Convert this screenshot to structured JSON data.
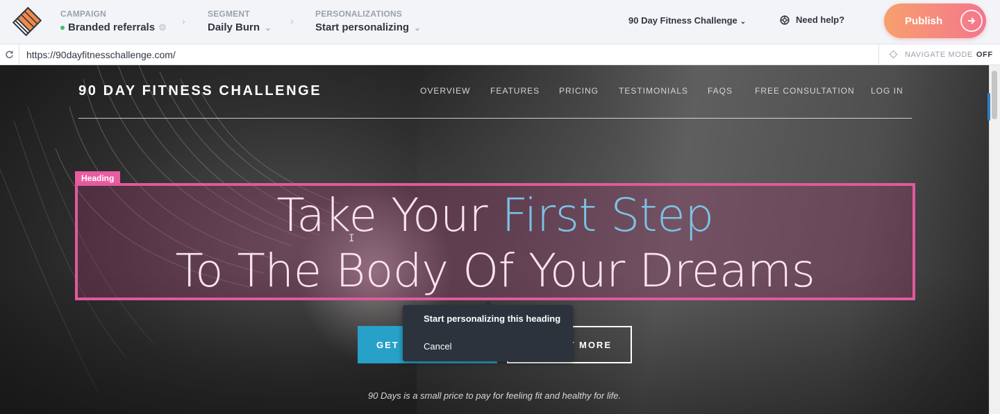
{
  "toolbar": {
    "logo_icon": "stacked-layers-logo",
    "campaign": {
      "label": "CAMPAIGN",
      "value": "Branded referrals",
      "status_color": "#3ac26f"
    },
    "segment": {
      "label": "SEGMENT",
      "value": "Daily Burn"
    },
    "personalizations": {
      "label": "PERSONALIZATIONS",
      "value": "Start personalizing"
    },
    "project": "90 Day Fitness Challenge",
    "help": "Need help?",
    "publish": "Publish",
    "publish_colors": [
      "#f7a06d",
      "#f4768c"
    ]
  },
  "urlbar": {
    "url": "https://90dayfitnesschallenge.com/",
    "navigate_mode_label": "NAVIGATE MODE",
    "navigate_mode_state": "OFF"
  },
  "site": {
    "title": "90 DAY FITNESS CHALLENGE",
    "nav": [
      "OVERVIEW",
      "FEATURES",
      "PRICING",
      "TESTIMONIALS",
      "FAQS",
      "FREE CONSULTATION",
      "LOG IN"
    ],
    "heading_tag": "Heading",
    "heading": {
      "line1_a": "Take Your ",
      "line1_b": "First Step",
      "line2": "To The Body Of Your Dreams"
    },
    "cta_primary": "GET S",
    "cta_secondary": "T MORE",
    "tagline": "90 Days is a small price to pay for feeling fit and healthy for life.",
    "accent_color": "#e05a9c",
    "highlight_color": "#7cc3e6"
  },
  "popup": {
    "items": [
      "Start personalizing this heading",
      "Cancel"
    ]
  }
}
